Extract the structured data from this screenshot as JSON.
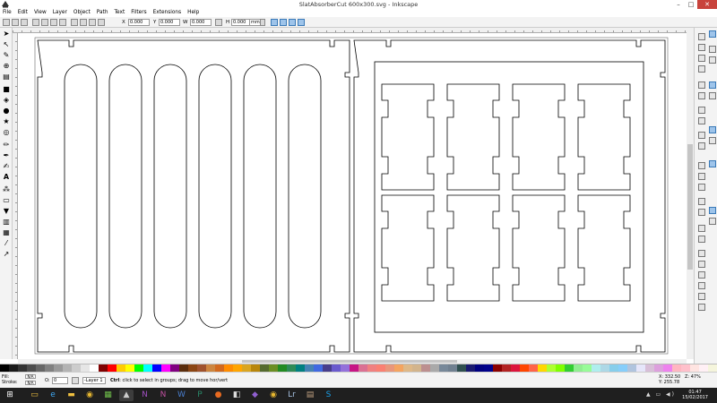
{
  "window": {
    "title": "SlatAbsorberCut 600x300.svg - Inkscape"
  },
  "menu": [
    "File",
    "Edit",
    "View",
    "Layer",
    "Object",
    "Path",
    "Text",
    "Filters",
    "Extensions",
    "Help"
  ],
  "controls": {
    "x_label": "X",
    "x_value": "0.000",
    "y_label": "Y",
    "y_value": "0.000",
    "w_label": "W",
    "w_value": "0.000",
    "h_label": "H",
    "h_value": "0.000",
    "unit": "mm"
  },
  "tools": [
    "selector-icon",
    "node-icon",
    "tweak-icon",
    "zoom-icon",
    "measure-icon",
    "rectangle-icon",
    "3dbox-icon",
    "ellipse-icon",
    "star-icon",
    "spiral-icon",
    "pencil-icon",
    "pen-icon",
    "calligraphy-icon",
    "text-icon",
    "spray-icon",
    "eraser-icon",
    "paint-bucket-icon",
    "gradient-icon",
    "mesh-icon",
    "dropper-icon",
    "connector-icon"
  ],
  "text_tool_glyph": "A",
  "status": {
    "fill_label": "Fill:",
    "fill_value": "N/A",
    "stroke_label": "Stroke:",
    "stroke_value": "N/A",
    "opacity_label": "O:",
    "opacity_value": "0",
    "layer": "-Layer 1",
    "message_bold": "Ctrl",
    "message": ": click to select in groups; drag to move hor/vert",
    "x_label": "X:",
    "x_value": "332.50",
    "y_label": "Y:",
    "y_value": "255.78",
    "z_label": "Z:",
    "z_value": "47%"
  },
  "clock": {
    "time": "01:47",
    "date": "15/02/2017"
  },
  "palette": [
    "#000000",
    "#1a1a1a",
    "#333333",
    "#4d4d4d",
    "#666666",
    "#808080",
    "#999999",
    "#b3b3b3",
    "#cccccc",
    "#e6e6e6",
    "#ffffff",
    "#800000",
    "#ff0000",
    "#ffcc00",
    "#ffff00",
    "#00ff00",
    "#00ffff",
    "#0000ff",
    "#ff00ff",
    "#800080",
    "#5a2d0c",
    "#8b4513",
    "#a0522d",
    "#cd853f",
    "#d2691e",
    "#ff8c00",
    "#ffa500",
    "#daa520",
    "#b8860b",
    "#556b2f",
    "#6b8e23",
    "#228b22",
    "#2e8b57",
    "#008080",
    "#4682b4",
    "#4169e1",
    "#483d8b",
    "#6a5acd",
    "#9370db",
    "#c71585",
    "#db7093",
    "#f08080",
    "#fa8072",
    "#e9967a",
    "#f4a460",
    "#deb887",
    "#d2b48c",
    "#bc8f8f",
    "#a9a9a9",
    "#778899",
    "#708090",
    "#2f4f4f",
    "#191970",
    "#000080",
    "#00008b",
    "#8b0000",
    "#b22222",
    "#dc143c",
    "#ff4500",
    "#ff6347",
    "#ffd700",
    "#adff2f",
    "#7fff00",
    "#32cd32",
    "#90ee90",
    "#98fb98",
    "#afeeee",
    "#add8e6",
    "#87ceeb",
    "#87cefa",
    "#b0c4de",
    "#e6e6fa",
    "#d8bfd8",
    "#dda0dd",
    "#ee82ee",
    "#ffb6c1",
    "#ffc0cb",
    "#ffe4e1",
    "#fff0f5",
    "#f5f5dc"
  ],
  "taskbar": [
    {
      "name": "start-button",
      "glyph": "⊞",
      "color": "#ffffff"
    },
    {
      "name": "file-explorer-taskbar-icon",
      "glyph": "▭",
      "color": "#f0c040"
    },
    {
      "name": "internet-explorer-taskbar-icon",
      "glyph": "e",
      "color": "#3fa9f5"
    },
    {
      "name": "folder-taskbar-icon",
      "glyph": "▬",
      "color": "#f0c040"
    },
    {
      "name": "chrome-taskbar-icon",
      "glyph": "◉",
      "color": "#e8b830"
    },
    {
      "name": "calculator-taskbar-icon",
      "glyph": "▦",
      "color": "#6fbf4a"
    },
    {
      "name": "inkscape-taskbar-icon",
      "glyph": "▲",
      "color": "#cccccc"
    },
    {
      "name": "onenote-taskbar-icon",
      "glyph": "N",
      "color": "#a04fc0"
    },
    {
      "name": "onenote2-taskbar-icon",
      "glyph": "N",
      "color": "#c050a0"
    },
    {
      "name": "word-taskbar-icon",
      "glyph": "W",
      "color": "#4a7fd0"
    },
    {
      "name": "publisher-taskbar-icon",
      "glyph": "P",
      "color": "#2a8a6a"
    },
    {
      "name": "firefox-taskbar-icon",
      "glyph": "●",
      "color": "#e86a20"
    },
    {
      "name": "kindle-taskbar-icon",
      "glyph": "◧",
      "color": "#dddddd"
    },
    {
      "name": "visual-studio-taskbar-icon",
      "glyph": "◆",
      "color": "#9060d0"
    },
    {
      "name": "chrome2-taskbar-icon",
      "glyph": "◉",
      "color": "#e8b830"
    },
    {
      "name": "lightroom-taskbar-icon",
      "glyph": "Lr",
      "color": "#a6c0e0"
    },
    {
      "name": "photo-app-taskbar-icon",
      "glyph": "▤",
      "color": "#c0a080"
    },
    {
      "name": "skype-taskbar-icon",
      "glyph": "S",
      "color": "#1aa0e8"
    }
  ]
}
